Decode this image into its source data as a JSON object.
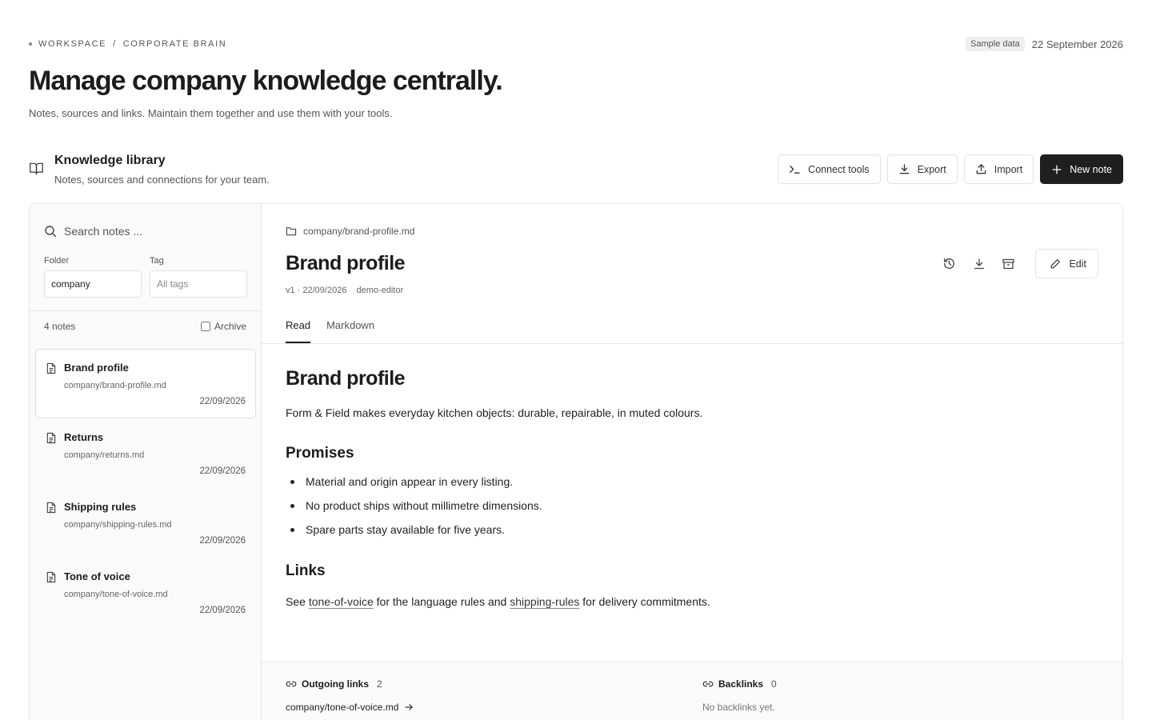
{
  "breadcrumb": {
    "workspace": "WORKSPACE",
    "separator": "/",
    "section": "CORPORATE BRAIN"
  },
  "topbar": {
    "badge": "Sample data",
    "date": "22 September 2026"
  },
  "hero": {
    "title": "Manage company knowledge centrally.",
    "subtitle": "Notes, sources and links. Maintain them together and use them with your tools."
  },
  "library": {
    "icon": "book-open-icon",
    "title": "Knowledge library",
    "subtitle": "Notes, sources and connections for your team.",
    "actions": {
      "connect_tools": "Connect tools",
      "export": "Export",
      "import": "Import",
      "new_note": "New note"
    }
  },
  "sidebar": {
    "search_placeholder": "Search notes ...",
    "folder_label": "Folder",
    "folder_value": "company",
    "tag_label": "Tag",
    "tag_placeholder": "All tags",
    "notes_count": "4 notes",
    "archive_label": "Archive",
    "archive_checked": false,
    "notes": [
      {
        "title": "Brand profile",
        "path": "company/brand-profile.md",
        "date": "22/09/2026",
        "active": true
      },
      {
        "title": "Returns",
        "path": "company/returns.md",
        "date": "22/09/2026",
        "active": false
      },
      {
        "title": "Shipping rules",
        "path": "company/shipping-rules.md",
        "date": "22/09/2026",
        "active": false
      },
      {
        "title": "Tone of voice",
        "path": "company/tone-of-voice.md",
        "date": "22/09/2026",
        "active": false
      }
    ]
  },
  "doc": {
    "path": "company/brand-profile.md",
    "title": "Brand profile",
    "version": "v1 · 22/09/2026",
    "author": "demo-editor",
    "edit_label": "Edit",
    "tabs": {
      "read": "Read",
      "markdown": "Markdown"
    },
    "active_tab": "Read"
  },
  "article": {
    "heading": "Brand profile",
    "intro": "Form & Field makes everyday kitchen objects: durable, repairable, in muted colours.",
    "promises_heading": "Promises",
    "promises": [
      "Material and origin appear in every listing.",
      "No product ships without millimetre dimensions.",
      "Spare parts stay available for five years."
    ],
    "links_heading": "Links",
    "links_text": {
      "see": "See",
      "link1": "tone-of-voice",
      "mid": "for the language rules and",
      "link2": "shipping-rules",
      "end": "for delivery commitments."
    }
  },
  "footer": {
    "outgoing_label": "Outgoing links",
    "outgoing_count": "2",
    "outgoing_first": "company/tone-of-voice.md",
    "backlinks_label": "Backlinks",
    "backlinks_count": "0",
    "backlinks_empty": "No backlinks yet."
  }
}
